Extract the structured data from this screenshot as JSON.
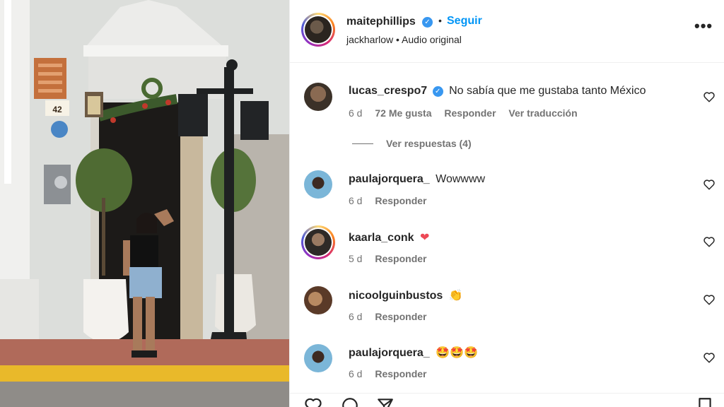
{
  "post": {
    "owner": "maitephillips",
    "follow_label": "Seguir",
    "separator": "•",
    "audio": "jackharlow • Audio original",
    "more_label": "•••",
    "verified_mark": "✓"
  },
  "photo": {
    "house_number": "42"
  },
  "comments": [
    {
      "user": "lucas_crespo7",
      "verified": true,
      "text": "No sabía que me gustaba tanto México",
      "time": "6 d",
      "likes": "72 Me gusta",
      "reply": "Responder",
      "translate": "Ver traducción"
    },
    {
      "user": "paulajorquera_",
      "text": "Wowwww",
      "time": "6 d",
      "reply": "Responder"
    },
    {
      "user": "kaarla_conk",
      "text": "❤",
      "time": "5 d",
      "reply": "Responder"
    },
    {
      "user": "nicoolguinbustos",
      "text": "👏",
      "time": "6 d",
      "reply": "Responder"
    },
    {
      "user": "paulajorquera_",
      "text": "🤩🤩🤩",
      "time": "6 d",
      "reply": "Responder"
    }
  ],
  "view_replies": "Ver respuestas (4)",
  "icons": [
    "verified-badge-icon",
    "more-options-icon",
    "heart-icon",
    "comment-icon",
    "share-icon",
    "bookmark-icon"
  ],
  "colors": {
    "accent": "#0095f6",
    "verified": "#3897f0",
    "muted": "#737373",
    "text": "#262626",
    "heart_red": "#ed4956"
  }
}
